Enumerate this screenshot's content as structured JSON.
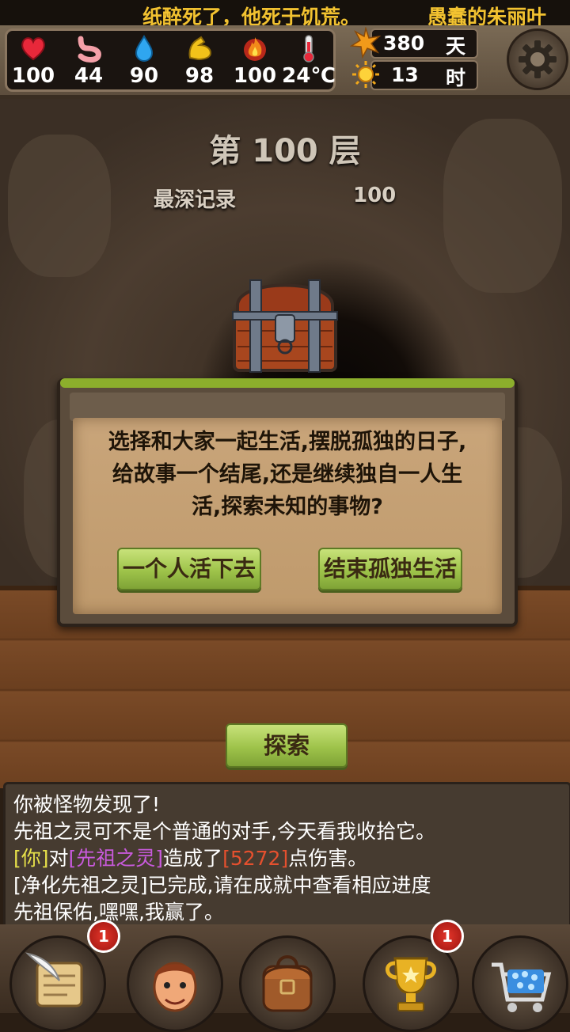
{
  "marquee": {
    "segments": [
      "纸醉死了，他死于饥荒。",
      "愚蠢的朱丽叶"
    ]
  },
  "stats": [
    {
      "icon": "heart-icon",
      "value": "100"
    },
    {
      "icon": "stomach-icon",
      "value": "44"
    },
    {
      "icon": "water-drop-icon",
      "value": "90"
    },
    {
      "icon": "muscle-icon",
      "value": "98"
    },
    {
      "icon": "fire-icon",
      "value": "100"
    },
    {
      "icon": "thermometer-icon",
      "value": "24℃"
    }
  ],
  "time": {
    "days_value": "380",
    "days_unit": "天",
    "hours_value": "13",
    "hours_unit": "时"
  },
  "floor": {
    "title": "第 100 层",
    "record_label": "最深记录",
    "record_value": "100"
  },
  "dialog": {
    "lines": [
      "选择和大家一起生活,摆脱孤独的日子,",
      "给故事一个结尾,还是继续独自一人生",
      "活,探索未知的事物?"
    ],
    "option_alone": "一个人活下去",
    "option_end": "结束孤独生活"
  },
  "explore_label": "探索",
  "log": {
    "line1": "你被怪物发现了!",
    "line2": "先祖之灵可不是个普通的对手,今天看我收拾它。",
    "line3": {
      "you": "[你]",
      "to": "对",
      "target": "[先祖之灵]",
      "caused": "造成了",
      "damage": "[5272]",
      "suffix": "点伤害。"
    },
    "line4": "[净化先祖之灵]已完成,请在成就中查看相应进度",
    "line5": "先祖保佑,嘿嘿,我赢了。"
  },
  "nav": [
    {
      "icon": "scroll-quill-icon",
      "badge": "1"
    },
    {
      "icon": "character-portrait-icon",
      "badge": ""
    },
    {
      "icon": "backpack-icon",
      "badge": ""
    },
    {
      "icon": "trophy-icon",
      "badge": "1"
    },
    {
      "icon": "shop-cart-icon",
      "badge": ""
    }
  ],
  "colors": {
    "marquee_text": "#f2c230",
    "log_you": "#e6e04a",
    "log_target": "#c85adc",
    "log_damage": "#e5502e",
    "button_green": "#9ec34a"
  }
}
